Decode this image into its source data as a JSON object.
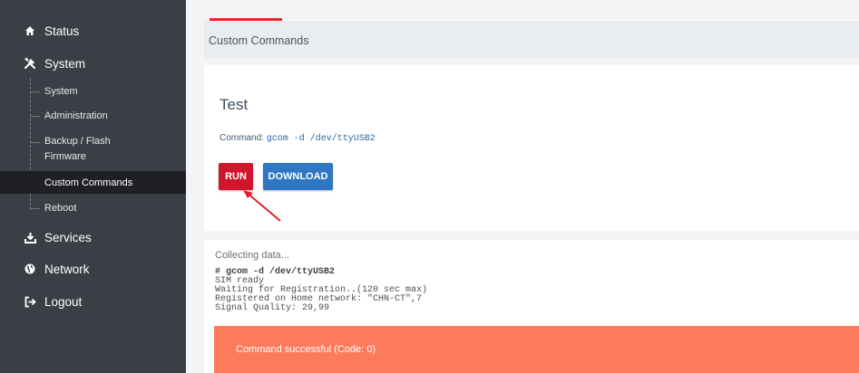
{
  "sidebar": {
    "status": {
      "label": "Status",
      "icon": "home-icon"
    },
    "system": {
      "label": "System",
      "icon": "tools-icon"
    },
    "sub_items": [
      {
        "label": "System"
      },
      {
        "label": "Administration"
      },
      {
        "label": "Backup / Flash",
        "label2": "Firmware"
      },
      {
        "label": "Custom Commands"
      },
      {
        "label": "Reboot"
      }
    ],
    "services": {
      "label": "Services",
      "icon": "download-icon"
    },
    "network": {
      "label": "Network",
      "icon": "globe-icon"
    },
    "logout": {
      "label": "Logout",
      "icon": "logout-icon"
    }
  },
  "header": {
    "breadcrumb": "Custom Commands"
  },
  "panel": {
    "title": "Test",
    "command_label": "Command:",
    "command_value": "gcom -d /dev/ttyUSB2",
    "run_label": "RUN",
    "download_label": "DOWNLOAD"
  },
  "output": {
    "collecting": "Collecting data...",
    "log_command": "# gcom -d /dev/ttyUSB2",
    "log_lines": [
      "SIM ready",
      "Waiting for Registration..(120 sec max)",
      "Registered on Home network: \"CHN-CT\",7",
      "Signal Quality: 29,99"
    ],
    "alert": "Command successful (Code: 0)"
  },
  "colors": {
    "sidebar_bg": "#3b3e45",
    "active_bg": "#1e2025",
    "accent_red": "#d0162a",
    "accent_blue": "#2f76c3",
    "alert_bg": "#fd7b5d"
  }
}
